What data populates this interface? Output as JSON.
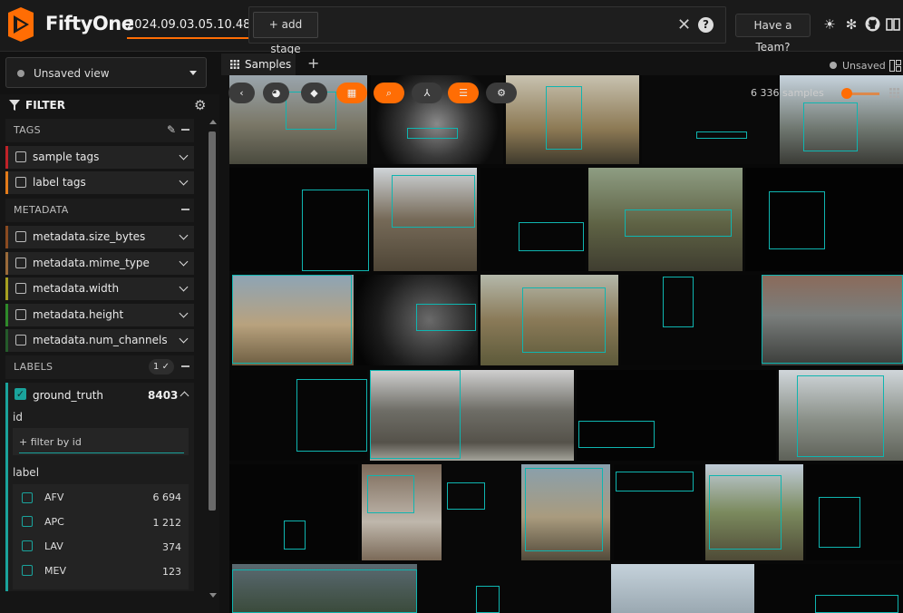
{
  "header": {
    "app_title": "FiftyOne",
    "dataset_name": "2024.09.03.05.10.48",
    "add_stage_label": "+ add stage",
    "team_button": "Have a Team?",
    "help_glyph": "?"
  },
  "view_select": {
    "label": "Unsaved view"
  },
  "filter": {
    "title": "FILTER",
    "sections": {
      "tags": "TAGS",
      "metadata": "METADATA",
      "labels": "LABELS"
    },
    "tag_rows": [
      "sample tags",
      "label tags"
    ],
    "metadata_rows": [
      "metadata.size_bytes",
      "metadata.mime_type",
      "metadata.width",
      "metadata.height",
      "metadata.num_channels"
    ],
    "labels_count": "1",
    "ground_truth": {
      "name": "ground_truth",
      "count": "8403"
    },
    "id_label": "id",
    "id_placeholder": "+ filter by id",
    "label_field": "label",
    "label_values": [
      {
        "name": "AFV",
        "count": "6 694"
      },
      {
        "name": "APC",
        "count": "1 212"
      },
      {
        "name": "LAV",
        "count": "374"
      },
      {
        "name": "MEV",
        "count": "123"
      }
    ]
  },
  "grid": {
    "tab_label": "Samples",
    "new_tab": "+",
    "status": "Unsaved",
    "sample_count": "6 336 samples"
  },
  "colors": {
    "accent": "#ff6d04",
    "bbox": "#0fb5b0"
  },
  "icons": [
    "back-icon",
    "palette-icon",
    "tag-icon",
    "grid-select-icon",
    "search-icon",
    "merge-icon",
    "list-icon",
    "gear-icon"
  ]
}
